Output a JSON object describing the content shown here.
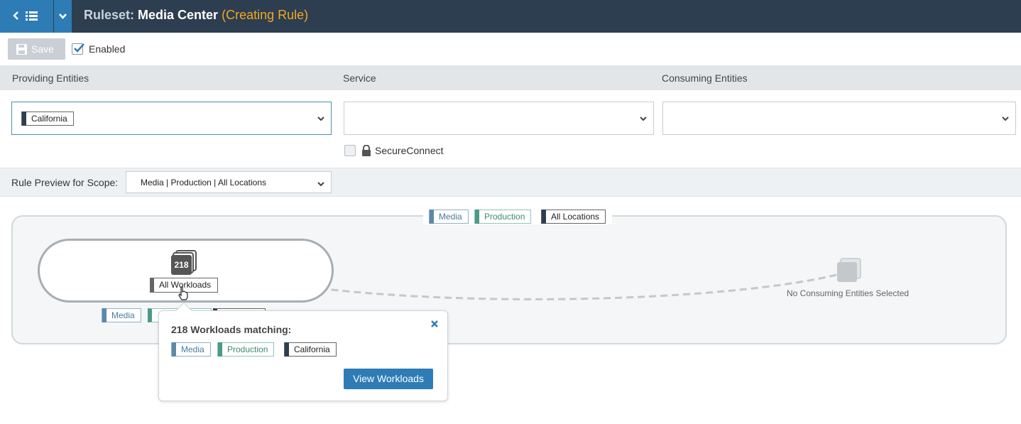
{
  "header": {
    "title_label": "Ruleset:",
    "title_name": "Media Center",
    "title_state": "(Creating Rule)"
  },
  "toolbar": {
    "save_label": "Save",
    "enabled_label": "Enabled",
    "enabled_checked": true
  },
  "columns": {
    "providing": "Providing Entities",
    "service": "Service",
    "consuming": "Consuming Entities"
  },
  "providing_select": {
    "chips": [
      "California"
    ]
  },
  "service_select": {
    "value": ""
  },
  "consuming_select": {
    "value": ""
  },
  "secure_connect": {
    "label": "SecureConnect",
    "checked": false
  },
  "scope": {
    "label": "Rule Preview for Scope:",
    "value": "Media | Production | All Locations"
  },
  "preview": {
    "scope_chips": [
      "Media",
      "Production",
      "All Locations"
    ],
    "provider": {
      "count": "218",
      "label": "All Workloads",
      "chips": [
        "Media"
      ]
    },
    "consumer": {
      "label": "No Consuming Entities Selected"
    }
  },
  "popover": {
    "title": "218 Workloads matching:",
    "chips": [
      "Media",
      "Production",
      "California"
    ],
    "button_label": "View Workloads"
  },
  "colors": {
    "header_bg": "#2d3e50",
    "accent_blue": "#2e7cb5",
    "state_orange": "#f5a623",
    "media_label": "#5c8aa8",
    "production_label": "#4a9a86"
  }
}
